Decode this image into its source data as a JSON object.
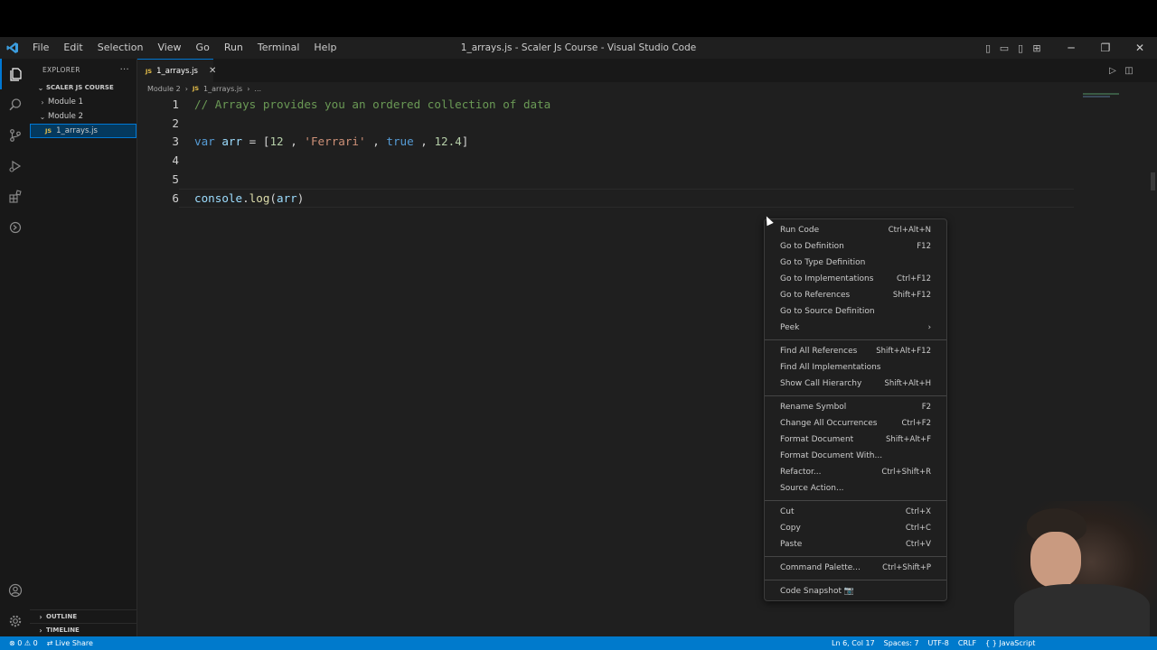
{
  "window": {
    "title": "1_arrays.js - Scaler Js Course - Visual Studio Code",
    "logo": "vscode-logo",
    "menu": [
      "File",
      "Edit",
      "Selection",
      "View",
      "Go",
      "Run",
      "Terminal",
      "Help"
    ]
  },
  "sidebar": {
    "header": "EXPLORER",
    "project": "SCALER JS COURSE",
    "tree": [
      {
        "label": "Module 1",
        "state": "collapsed"
      },
      {
        "label": "Module 2",
        "state": "expanded"
      },
      {
        "label": "1_arrays.js",
        "badge": "JS",
        "selected": true
      }
    ],
    "outline": "OUTLINE",
    "timeline": "TIMELINE"
  },
  "tab": {
    "badge": "JS",
    "label": "1_arrays.js",
    "close": "✕"
  },
  "breadcrumb": {
    "folder": "Module 2",
    "badge": "JS",
    "file": "1_arrays.js",
    "tail": "..."
  },
  "code": {
    "lines": [
      "1",
      "2",
      "3",
      "4",
      "5",
      "6"
    ],
    "l1": "// Arrays provides you an ordered collection of data",
    "l3": {
      "kw": "var",
      "name": "arr",
      "eq": " = ",
      "open": "[",
      "n1": "12",
      "c1": " , ",
      "s1": "'Ferrari'",
      "c2": " , ",
      "b1": "true",
      "c3": " , ",
      "n2": "12.4",
      "close": "]"
    },
    "l6": {
      "obj": "console",
      "dot": ".",
      "fn": "log",
      "open": "(",
      "arg": "arr",
      "close": ")"
    }
  },
  "context_menu": {
    "groups": [
      [
        {
          "label": "Run Code",
          "key": "Ctrl+Alt+N"
        },
        {
          "label": "Go to Definition",
          "key": "F12"
        },
        {
          "label": "Go to Type Definition",
          "key": ""
        },
        {
          "label": "Go to Implementations",
          "key": "Ctrl+F12"
        },
        {
          "label": "Go to References",
          "key": "Shift+F12"
        },
        {
          "label": "Go to Source Definition",
          "key": ""
        },
        {
          "label": "Peek",
          "key": "›"
        }
      ],
      [
        {
          "label": "Find All References",
          "key": "Shift+Alt+F12"
        },
        {
          "label": "Find All Implementations",
          "key": ""
        },
        {
          "label": "Show Call Hierarchy",
          "key": "Shift+Alt+H"
        }
      ],
      [
        {
          "label": "Rename Symbol",
          "key": "F2"
        },
        {
          "label": "Change All Occurrences",
          "key": "Ctrl+F2"
        },
        {
          "label": "Format Document",
          "key": "Shift+Alt+F"
        },
        {
          "label": "Format Document With...",
          "key": ""
        },
        {
          "label": "Refactor...",
          "key": "Ctrl+Shift+R"
        },
        {
          "label": "Source Action...",
          "key": ""
        }
      ],
      [
        {
          "label": "Cut",
          "key": "Ctrl+X"
        },
        {
          "label": "Copy",
          "key": "Ctrl+C"
        },
        {
          "label": "Paste",
          "key": "Ctrl+V"
        }
      ],
      [
        {
          "label": "Command Palette...",
          "key": "Ctrl+Shift+P"
        }
      ],
      [
        {
          "label": "Code Snapshot 📷",
          "key": ""
        }
      ]
    ]
  },
  "status": {
    "errors": "⊗ 0 ⚠ 0",
    "live_share": "Live Share",
    "position": "Ln 6, Col 17",
    "spaces": "Spaces: 7",
    "encoding": "UTF-8",
    "eol": "CRLF",
    "language": "{ } JavaScript"
  },
  "colors": {
    "accent": "#0078d4",
    "statusbar": "#007acc",
    "editor_bg": "#1f1f1f"
  }
}
